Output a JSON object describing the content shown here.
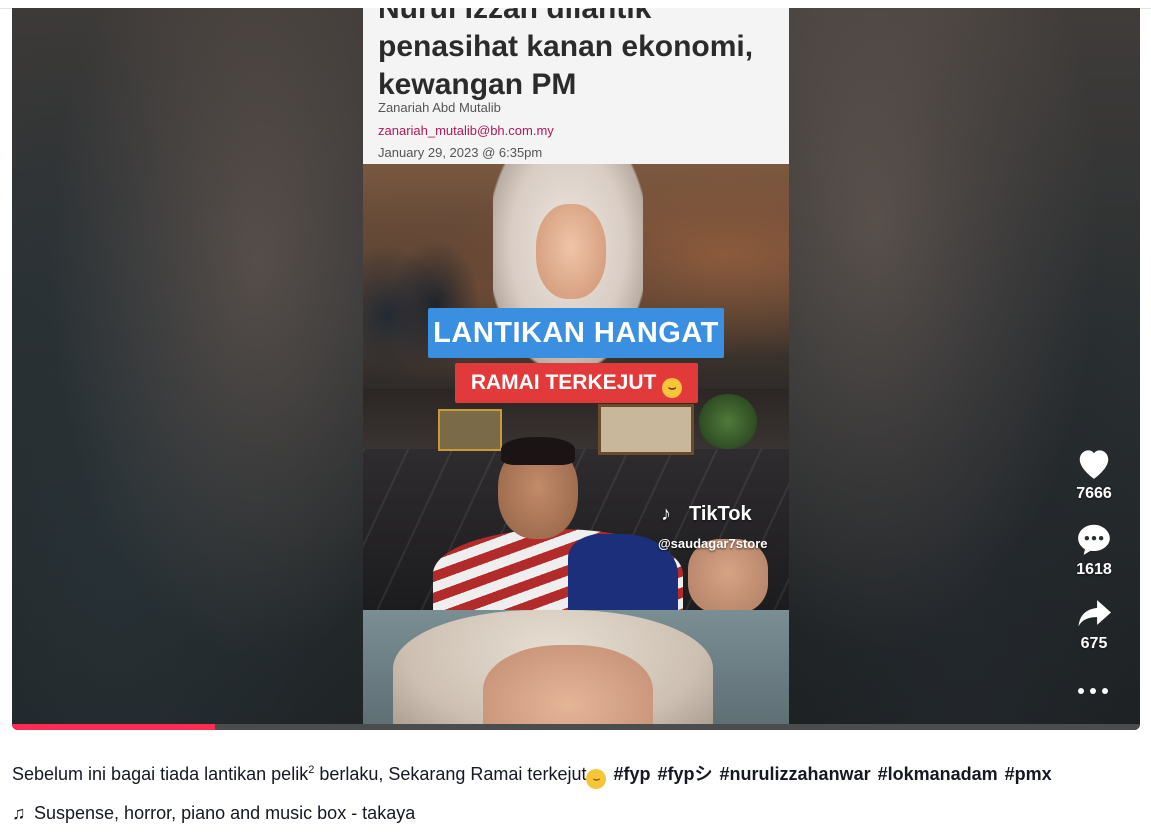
{
  "video": {
    "article": {
      "headline_line1": "Nurul Izzah dilantik",
      "headline_line2": "penasihat kanan ekonomi,",
      "headline_line3": "kewangan PM",
      "author": "Zanariah Abd Mutalib",
      "email": "zanariah_mutalib@bh.com.my",
      "date": "January 29, 2023 @ 6:35pm"
    },
    "overlay_title": "LANTIKAN HANGAT",
    "overlay_subtitle": "RAMAI TERKEJUT",
    "watermark": "TikTok",
    "handle": "@saudagar7store",
    "progress_fraction": 0.18
  },
  "actions": {
    "likes": "7666",
    "comments": "1618",
    "shares": "675"
  },
  "caption": {
    "text_before": "Sebelum ini bagai tiada lantikan pelik",
    "superscript": "2",
    "text_after": " berlaku, Sekarang Ramai terkejut",
    "hashtags": [
      "#fyp",
      "#fypシ",
      "#nurulizzahanwar",
      "#lokmanadam",
      "#pmx"
    ]
  },
  "music": {
    "title": "Suspense, horror, piano and music box - takaya"
  },
  "colors": {
    "accent": "#fe2c55",
    "tag_blue": "#3b8fe0",
    "tag_red": "#e23a3a"
  }
}
